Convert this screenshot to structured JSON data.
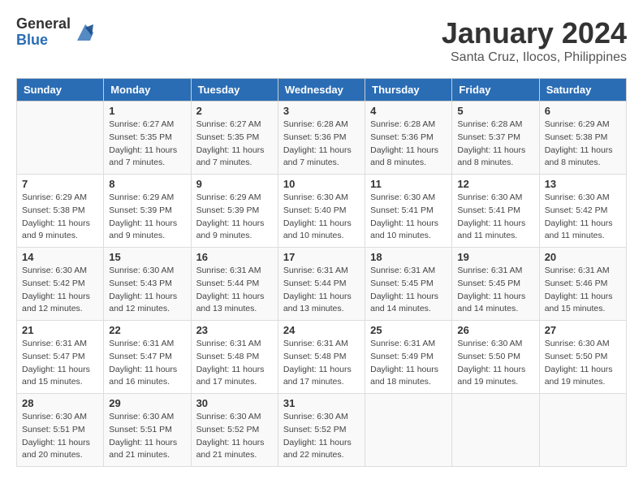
{
  "header": {
    "logo_general": "General",
    "logo_blue": "Blue",
    "month": "January 2024",
    "location": "Santa Cruz, Ilocos, Philippines"
  },
  "days_of_week": [
    "Sunday",
    "Monday",
    "Tuesday",
    "Wednesday",
    "Thursday",
    "Friday",
    "Saturday"
  ],
  "weeks": [
    [
      {
        "num": "",
        "sunrise": "",
        "sunset": "",
        "daylight": ""
      },
      {
        "num": "1",
        "sunrise": "Sunrise: 6:27 AM",
        "sunset": "Sunset: 5:35 PM",
        "daylight": "Daylight: 11 hours and 7 minutes."
      },
      {
        "num": "2",
        "sunrise": "Sunrise: 6:27 AM",
        "sunset": "Sunset: 5:35 PM",
        "daylight": "Daylight: 11 hours and 7 minutes."
      },
      {
        "num": "3",
        "sunrise": "Sunrise: 6:28 AM",
        "sunset": "Sunset: 5:36 PM",
        "daylight": "Daylight: 11 hours and 7 minutes."
      },
      {
        "num": "4",
        "sunrise": "Sunrise: 6:28 AM",
        "sunset": "Sunset: 5:36 PM",
        "daylight": "Daylight: 11 hours and 8 minutes."
      },
      {
        "num": "5",
        "sunrise": "Sunrise: 6:28 AM",
        "sunset": "Sunset: 5:37 PM",
        "daylight": "Daylight: 11 hours and 8 minutes."
      },
      {
        "num": "6",
        "sunrise": "Sunrise: 6:29 AM",
        "sunset": "Sunset: 5:38 PM",
        "daylight": "Daylight: 11 hours and 8 minutes."
      }
    ],
    [
      {
        "num": "7",
        "sunrise": "Sunrise: 6:29 AM",
        "sunset": "Sunset: 5:38 PM",
        "daylight": "Daylight: 11 hours and 9 minutes."
      },
      {
        "num": "8",
        "sunrise": "Sunrise: 6:29 AM",
        "sunset": "Sunset: 5:39 PM",
        "daylight": "Daylight: 11 hours and 9 minutes."
      },
      {
        "num": "9",
        "sunrise": "Sunrise: 6:29 AM",
        "sunset": "Sunset: 5:39 PM",
        "daylight": "Daylight: 11 hours and 9 minutes."
      },
      {
        "num": "10",
        "sunrise": "Sunrise: 6:30 AM",
        "sunset": "Sunset: 5:40 PM",
        "daylight": "Daylight: 11 hours and 10 minutes."
      },
      {
        "num": "11",
        "sunrise": "Sunrise: 6:30 AM",
        "sunset": "Sunset: 5:41 PM",
        "daylight": "Daylight: 11 hours and 10 minutes."
      },
      {
        "num": "12",
        "sunrise": "Sunrise: 6:30 AM",
        "sunset": "Sunset: 5:41 PM",
        "daylight": "Daylight: 11 hours and 11 minutes."
      },
      {
        "num": "13",
        "sunrise": "Sunrise: 6:30 AM",
        "sunset": "Sunset: 5:42 PM",
        "daylight": "Daylight: 11 hours and 11 minutes."
      }
    ],
    [
      {
        "num": "14",
        "sunrise": "Sunrise: 6:30 AM",
        "sunset": "Sunset: 5:42 PM",
        "daylight": "Daylight: 11 hours and 12 minutes."
      },
      {
        "num": "15",
        "sunrise": "Sunrise: 6:30 AM",
        "sunset": "Sunset: 5:43 PM",
        "daylight": "Daylight: 11 hours and 12 minutes."
      },
      {
        "num": "16",
        "sunrise": "Sunrise: 6:31 AM",
        "sunset": "Sunset: 5:44 PM",
        "daylight": "Daylight: 11 hours and 13 minutes."
      },
      {
        "num": "17",
        "sunrise": "Sunrise: 6:31 AM",
        "sunset": "Sunset: 5:44 PM",
        "daylight": "Daylight: 11 hours and 13 minutes."
      },
      {
        "num": "18",
        "sunrise": "Sunrise: 6:31 AM",
        "sunset": "Sunset: 5:45 PM",
        "daylight": "Daylight: 11 hours and 14 minutes."
      },
      {
        "num": "19",
        "sunrise": "Sunrise: 6:31 AM",
        "sunset": "Sunset: 5:45 PM",
        "daylight": "Daylight: 11 hours and 14 minutes."
      },
      {
        "num": "20",
        "sunrise": "Sunrise: 6:31 AM",
        "sunset": "Sunset: 5:46 PM",
        "daylight": "Daylight: 11 hours and 15 minutes."
      }
    ],
    [
      {
        "num": "21",
        "sunrise": "Sunrise: 6:31 AM",
        "sunset": "Sunset: 5:47 PM",
        "daylight": "Daylight: 11 hours and 15 minutes."
      },
      {
        "num": "22",
        "sunrise": "Sunrise: 6:31 AM",
        "sunset": "Sunset: 5:47 PM",
        "daylight": "Daylight: 11 hours and 16 minutes."
      },
      {
        "num": "23",
        "sunrise": "Sunrise: 6:31 AM",
        "sunset": "Sunset: 5:48 PM",
        "daylight": "Daylight: 11 hours and 17 minutes."
      },
      {
        "num": "24",
        "sunrise": "Sunrise: 6:31 AM",
        "sunset": "Sunset: 5:48 PM",
        "daylight": "Daylight: 11 hours and 17 minutes."
      },
      {
        "num": "25",
        "sunrise": "Sunrise: 6:31 AM",
        "sunset": "Sunset: 5:49 PM",
        "daylight": "Daylight: 11 hours and 18 minutes."
      },
      {
        "num": "26",
        "sunrise": "Sunrise: 6:30 AM",
        "sunset": "Sunset: 5:50 PM",
        "daylight": "Daylight: 11 hours and 19 minutes."
      },
      {
        "num": "27",
        "sunrise": "Sunrise: 6:30 AM",
        "sunset": "Sunset: 5:50 PM",
        "daylight": "Daylight: 11 hours and 19 minutes."
      }
    ],
    [
      {
        "num": "28",
        "sunrise": "Sunrise: 6:30 AM",
        "sunset": "Sunset: 5:51 PM",
        "daylight": "Daylight: 11 hours and 20 minutes."
      },
      {
        "num": "29",
        "sunrise": "Sunrise: 6:30 AM",
        "sunset": "Sunset: 5:51 PM",
        "daylight": "Daylight: 11 hours and 21 minutes."
      },
      {
        "num": "30",
        "sunrise": "Sunrise: 6:30 AM",
        "sunset": "Sunset: 5:52 PM",
        "daylight": "Daylight: 11 hours and 21 minutes."
      },
      {
        "num": "31",
        "sunrise": "Sunrise: 6:30 AM",
        "sunset": "Sunset: 5:52 PM",
        "daylight": "Daylight: 11 hours and 22 minutes."
      },
      {
        "num": "",
        "sunrise": "",
        "sunset": "",
        "daylight": ""
      },
      {
        "num": "",
        "sunrise": "",
        "sunset": "",
        "daylight": ""
      },
      {
        "num": "",
        "sunrise": "",
        "sunset": "",
        "daylight": ""
      }
    ]
  ]
}
